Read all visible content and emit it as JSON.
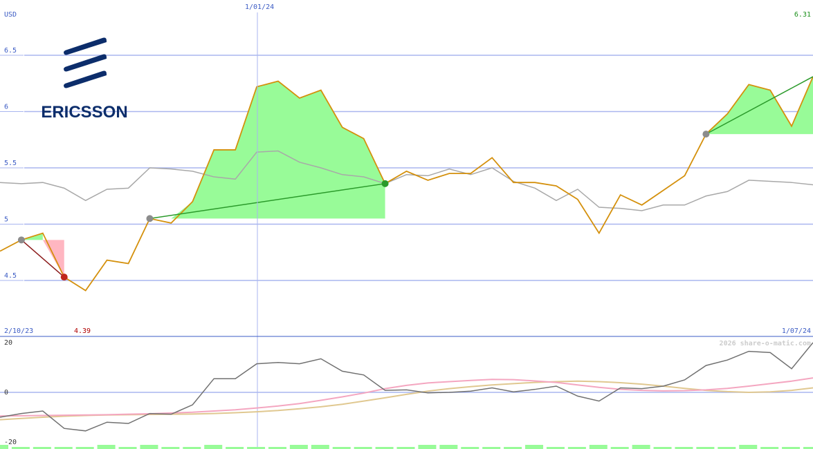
{
  "brand": {
    "name": "ERICSSON",
    "color": "#0c2d6b"
  },
  "colors": {
    "axis_text": "#3b5bc4",
    "grid": "#a9b6ef",
    "price_line": "#d4900c",
    "gain_fill": "#98fb98",
    "loss_fill": "#ffb6c1",
    "gain_line": "#2a9a2a",
    "loss_line": "#8b1a1a",
    "neutral_marker": "#8c8c8c",
    "compare_line": "#a8a8a8",
    "osc_line": "#707070",
    "osc_pink": "#f4a6c0",
    "osc_tan": "#e0c890",
    "last_price_color": "#1a8f1a",
    "low_price_color": "#b00000",
    "watermark_color": "#cccccc"
  },
  "chart_data": [
    {
      "type": "line",
      "ylabel": "USD",
      "ylim": [
        4.05,
        6.7
      ],
      "yticks": [
        4.5,
        5,
        5.5,
        6,
        6.5
      ],
      "ytick_labels": [
        "4.5",
        "5",
        "5.5",
        "6",
        "6.5"
      ],
      "x_start_label": "2/10/23",
      "x_end_label": "1/07/24",
      "x_marker_label": "1/01/24",
      "low_label": "4.39",
      "last_label": "6.31",
      "grid": true,
      "series": [
        {
          "values": [
            4.76,
            4.86,
            4.92,
            4.53,
            4.41,
            4.68,
            4.65,
            5.05,
            5.01,
            5.2,
            5.66,
            5.66,
            6.22,
            6.27,
            6.12,
            6.19,
            5.86,
            5.76,
            5.36,
            5.47,
            5.39,
            5.45,
            5.45,
            5.59,
            5.37,
            5.37,
            5.34,
            5.22,
            4.92,
            5.26,
            5.17,
            5.3,
            5.43,
            5.8,
            5.98,
            6.24,
            6.19,
            5.87,
            6.31
          ]
        },
        {
          "values": [
            5.37,
            5.36,
            5.37,
            5.32,
            5.21,
            5.31,
            5.32,
            5.5,
            5.49,
            5.47,
            5.42,
            5.4,
            5.64,
            5.65,
            5.55,
            5.5,
            5.44,
            5.42,
            5.36,
            5.44,
            5.43,
            5.49,
            5.44,
            5.5,
            5.38,
            5.32,
            5.21,
            5.31,
            5.15,
            5.14,
            5.12,
            5.17,
            5.17,
            5.25,
            5.29,
            5.39,
            5.38,
            5.37,
            5.35
          ]
        }
      ],
      "trades": [
        {
          "from": 1,
          "to": 3,
          "from_price": 4.86,
          "to_price": 4.53,
          "result": "loss"
        },
        {
          "from": 7,
          "to": 18,
          "from_price": 5.05,
          "to_price": 5.36,
          "result": "gain"
        },
        {
          "from": 33,
          "to": 38,
          "from_price": 5.8,
          "to_price": 6.31,
          "result": "gain"
        }
      ]
    },
    {
      "type": "line",
      "ylim": [
        -20,
        20
      ],
      "yticks": [
        20,
        0,
        -20
      ],
      "ytick_labels": [
        "20",
        "0",
        "-20"
      ],
      "grid": true,
      "series": [
        {
          "values": [
            -10,
            -8.5,
            -7.5,
            -14.5,
            -15.5,
            -12,
            -12.5,
            -8.5,
            -8.8,
            -5,
            5.5,
            5.5,
            11.5,
            12,
            11.5,
            13.5,
            8.5,
            7,
            0.8,
            1,
            -0.2,
            0,
            0.5,
            1.8,
            0.2,
            1.2,
            2.5,
            -1.5,
            -3.5,
            1.8,
            1.5,
            2.5,
            5,
            10.8,
            13,
            16.5,
            16,
            9.5,
            20
          ]
        },
        {
          "values": [
            -9.5,
            -9.4,
            -9.3,
            -9.2,
            -9.1,
            -9,
            -8.8,
            -8.6,
            -8.3,
            -8,
            -7.5,
            -7,
            -6.3,
            -5.5,
            -4.5,
            -3.2,
            -1.8,
            -0.3,
            1.5,
            2.8,
            3.8,
            4.3,
            4.8,
            5.2,
            5.1,
            4.6,
            4,
            3,
            2,
            1.2,
            0.8,
            0.6,
            0.7,
            1,
            1.6,
            2.5,
            3.5,
            4.5,
            5.8
          ]
        },
        {
          "values": [
            -11,
            -10.5,
            -10,
            -9.6,
            -9.3,
            -9.1,
            -9,
            -8.9,
            -8.8,
            -8.7,
            -8.5,
            -8.2,
            -7.8,
            -7.3,
            -6.6,
            -5.8,
            -4.8,
            -3.5,
            -2.2,
            -0.8,
            0.5,
            1.5,
            2.3,
            3,
            3.5,
            4,
            4.3,
            4.5,
            4.3,
            3.9,
            3.3,
            2.5,
            1.6,
            0.8,
            0.3,
            0,
            0.2,
            0.8,
            1.8
          ]
        }
      ]
    }
  ],
  "watermark": "2026 share-o-matic.com"
}
